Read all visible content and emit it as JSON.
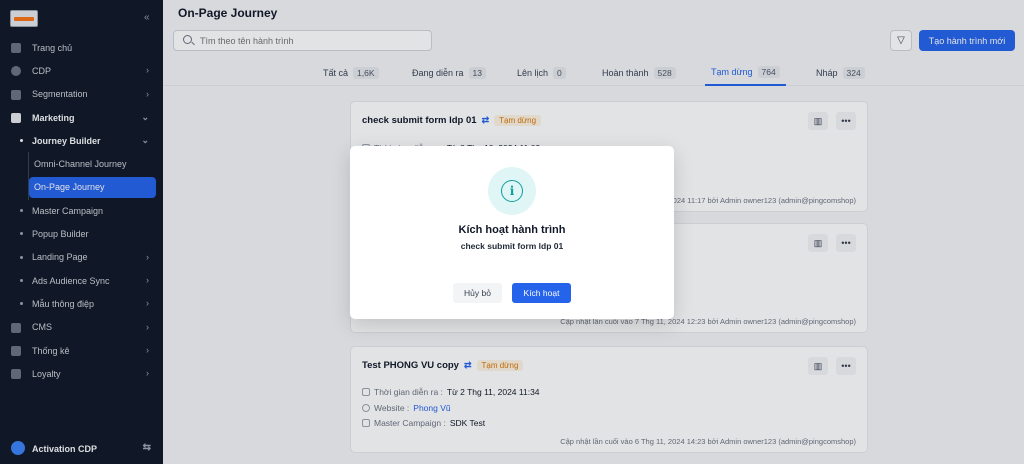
{
  "sidebar": {
    "items": [
      {
        "label": "Trang chủ"
      },
      {
        "label": "CDP"
      },
      {
        "label": "Segmentation"
      },
      {
        "label": "Marketing"
      },
      {
        "label": "Journey Builder"
      },
      {
        "label": "Omni-Channel Journey"
      },
      {
        "label": "On-Page Journey"
      },
      {
        "label": "Master Campaign"
      },
      {
        "label": "Popup Builder"
      },
      {
        "label": "Landing Page"
      },
      {
        "label": "Ads Audience Sync"
      },
      {
        "label": "Mẫu thông điệp"
      },
      {
        "label": "CMS"
      },
      {
        "label": "Thống kê"
      },
      {
        "label": "Loyalty"
      }
    ],
    "footer_label": "Activation CDP"
  },
  "header": {
    "title": "On-Page Journey",
    "search_placeholder": "Tìm theo tên hành trình",
    "new_button": "Tạo hành trình mới"
  },
  "tabs": [
    {
      "label": "Tất cả",
      "count": "1,6K"
    },
    {
      "label": "Đang diễn ra",
      "count": "13"
    },
    {
      "label": "Lên lịch",
      "count": "0"
    },
    {
      "label": "Hoàn thành",
      "count": "528"
    },
    {
      "label": "Tạm dừng",
      "count": "764"
    },
    {
      "label": "Nháp",
      "count": "324"
    }
  ],
  "cards": [
    {
      "title": "check submit form ldp 01",
      "status": "Tạm dừng",
      "time_label": "Thời gian diễn ra :",
      "time_value": "Từ 8 Thg 10, 2024 11:09",
      "updated": "2024 11:17 bởi Admin owner123 (admin@pingcomshop)"
    },
    {
      "updated": "Cập nhật lần cuối vào 7 Thg 11, 2024 12:23 bởi Admin owner123 (admin@pingcomshop)"
    },
    {
      "title": "Test PHONG VU copy",
      "status": "Tạm dừng",
      "time_label": "Thời gian diễn ra :",
      "time_value": "Từ 2 Thg 11, 2024 11:34",
      "website_label": "Website :",
      "website_value": "Phong Vũ",
      "campaign_label": "Master Campaign :",
      "campaign_value": "SDK Test",
      "updated": "Cập nhật lần cuối vào 6 Thg 11, 2024 14:23 bởi Admin owner123 (admin@pingcomshop)"
    }
  ],
  "modal": {
    "title": "Kích hoạt hành trình",
    "subtitle": "check submit form ldp 01",
    "cancel": "Hủy bỏ",
    "confirm": "Kích hoạt"
  },
  "colors": {
    "accent": "#2563eb",
    "sidebar_bg": "#111827",
    "status_paused": "#d97706",
    "info_icon": "#0e9f9f"
  }
}
